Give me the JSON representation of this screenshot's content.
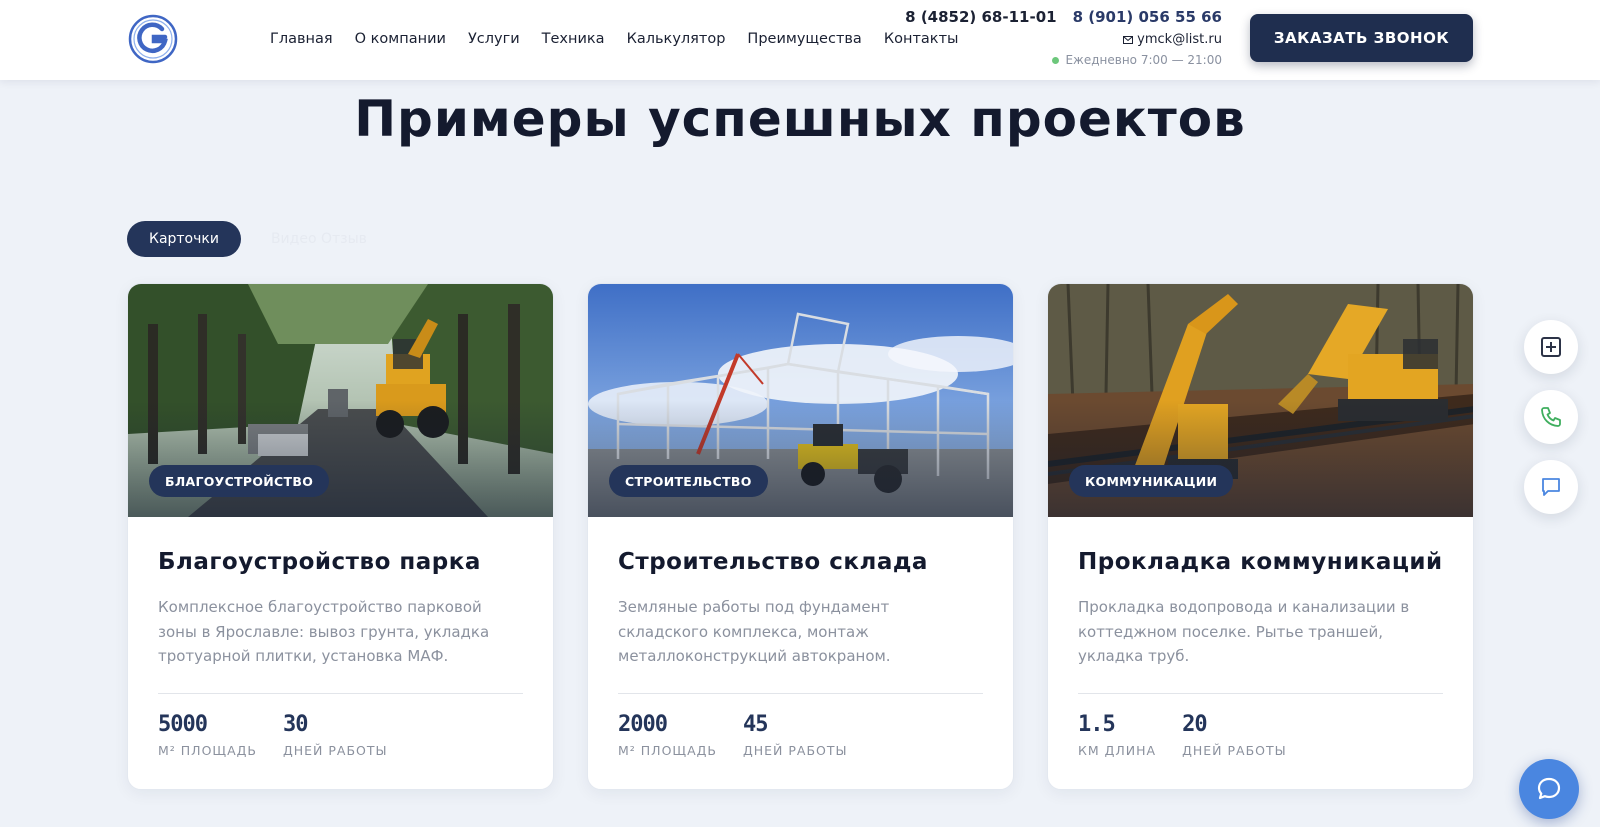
{
  "header": {
    "nav": [
      "Главная",
      "О компании",
      "Услуги",
      "Техника",
      "Калькулятор",
      "Преимущества",
      "Контакты"
    ],
    "phone_1": "8 (4852) 68-11-01",
    "phone_2": "8 (901) 056 55 66",
    "email": "ymck@list.ru",
    "hours": "Ежедневно 7:00 — 21:00",
    "cta_label": "ЗАКАЗАТЬ ЗВОНОК",
    "icons": {
      "logo": "g-logo-icon",
      "email": "envelope-icon",
      "status": "green-dot-icon"
    }
  },
  "section": {
    "title": "Примеры успешных проектов",
    "tabs": [
      {
        "label": "Карточки",
        "active": true
      },
      {
        "label": "Видео Отзыв",
        "active": false
      }
    ]
  },
  "projects": [
    {
      "badge": "БЛАГОУСТРОЙСТВО",
      "title": "Благоустройство парка",
      "description": "Комплексное благоустройство парковой зоны в Ярославле: вывоз грунта, укладка тротуарной плитки, установка МАФ.",
      "stats": [
        {
          "value": "5000",
          "label": "М² ПЛОЩАДЬ"
        },
        {
          "value": "30",
          "label": "ДНЕЙ РАБОТЫ"
        }
      ]
    },
    {
      "badge": "СТРОИТЕЛЬСТВО",
      "title": "Строительство склада",
      "description": "Земляные работы под фундамент складского комплекса, монтаж металлоконструкций автокраном.",
      "stats": [
        {
          "value": "2000",
          "label": "М² ПЛОЩАДЬ"
        },
        {
          "value": "45",
          "label": "ДНЕЙ РАБОТЫ"
        }
      ]
    },
    {
      "badge": "КОММУНИКАЦИИ",
      "title": "Прокладка коммуникаций",
      "description": "Прокладка водопровода и канализации в коттеджном поселке. Рытье траншей, укладка труб.",
      "stats": [
        {
          "value": "1.5",
          "label": "КМ ДЛИНА"
        },
        {
          "value": "20",
          "label": "ДНЕЙ РАБОТЫ"
        }
      ]
    }
  ],
  "floating": {
    "icons": [
      "plus-square-icon",
      "phone-icon",
      "message-icon"
    ],
    "chat_icon": "chat-bubble-icon"
  },
  "colors": {
    "primary": "#24355a",
    "accent": "#4a86e0",
    "background": "#eef2f8",
    "status": "#6cc77b"
  }
}
